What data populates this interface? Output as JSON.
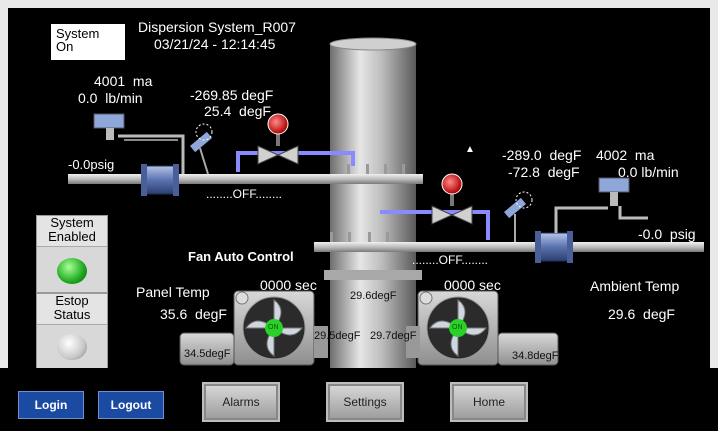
{
  "status": {
    "line1": "System",
    "line2": "On"
  },
  "header": {
    "title": "Dispersion System_R007",
    "datetime": "03/21/24 - 12:14:45"
  },
  "left_flow": {
    "current": "4001  ma",
    "flow": "0.0  lb/min",
    "pressure": "-0.0psig"
  },
  "left_temp": {
    "t1": "-269.85 degF",
    "t2": "25.4  degF"
  },
  "right_temp": {
    "t1": "-289.0  degF",
    "t2": "-72.8  degF"
  },
  "right_flow": {
    "current": "4002  ma",
    "flow": "0.0 lb/min",
    "pressure": "-0.0  psig"
  },
  "off_labels": {
    "upper": "........OFF........",
    "lower": "........OFF........"
  },
  "fan_auto_label": "Fan Auto Control",
  "side": {
    "system_enabled_1": "System",
    "system_enabled_2": "Enabled",
    "estop_1": "Estop",
    "estop_2": "Status"
  },
  "panel_temp": {
    "label": "Panel Temp",
    "value": "35.6  degF"
  },
  "ambient_temp": {
    "label": "Ambient Temp",
    "value": "29.6  degF"
  },
  "fans": {
    "left_timer": "0000 sec",
    "right_timer": "0000 sec",
    "left_badge": "ON",
    "right_badge": "ON"
  },
  "temps": {
    "center_top": "29.6degF",
    "center_left": "29.5degF",
    "center_right": "29.7degF",
    "left_motor": "34.5degF",
    "right_motor": "34.8degF"
  },
  "buttons": {
    "login": "Login",
    "logout": "Logout",
    "alarms": "Alarms",
    "settings": "Settings",
    "home": "Home"
  },
  "colors": {
    "background": "#000000",
    "pipe": "#c8c8c8",
    "blue_line": "#8a8aff",
    "lamp_on": "#2ecc2e",
    "button_blue": "#1b4aa3"
  }
}
